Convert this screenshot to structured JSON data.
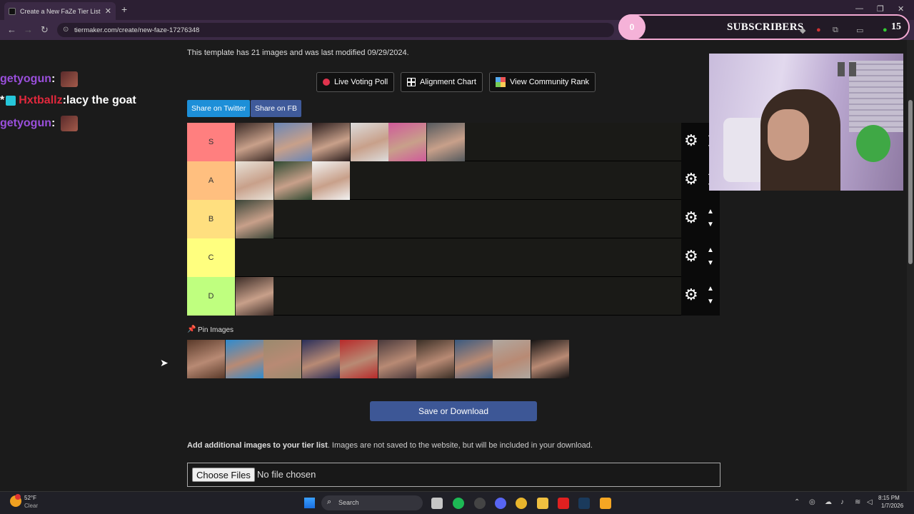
{
  "browser": {
    "tab_title": "Create a New FaZe Tier List - Ti",
    "tab_close": "✕",
    "new_tab": "+",
    "url": "tiermaker.com/create/new-faze-17276348",
    "back": "←",
    "forward": "→",
    "reload": "↻",
    "minimize": "—",
    "restore": "❐",
    "close": "✕"
  },
  "stream_overlay": {
    "subscriber_circle": "0",
    "subscribers_label": "SUBSCRIBERS",
    "subscriber_count": "15",
    "chat": [
      {
        "user": "getyogun",
        "sep": " :",
        "message": ""
      },
      {
        "user": "Hxtballz",
        "sep": " :",
        "message": " lacy the goat"
      },
      {
        "user": "getyogun",
        "sep": " :",
        "message": ""
      }
    ]
  },
  "page": {
    "info_text": "This template has 21 images and was last modified 09/29/2024.",
    "buttons": {
      "live_voting": "Live Voting Poll",
      "alignment_chart": "Alignment Chart",
      "community_rank": "View Community Rank",
      "share_twitter": "Share on Twitter",
      "share_fb": "Share on FB"
    },
    "tiers": [
      {
        "label": "S",
        "color": "#ff7f7f",
        "images": [
          "#3a2a26",
          "#6a86b6",
          "#2a1d1d",
          "#dcdcdc",
          "#d05a9a",
          "#555a5e"
        ]
      },
      {
        "label": "A",
        "color": "#ffbf7f",
        "images": [
          "#e8e2d8",
          "#2f4a32",
          "#f2f2f2"
        ]
      },
      {
        "label": "B",
        "color": "#ffdf7f",
        "images": [
          "#3a4538"
        ]
      },
      {
        "label": "C",
        "color": "#ffff7f",
        "images": []
      },
      {
        "label": "D",
        "color": "#bfff7f",
        "images": [
          "#3d2d28"
        ]
      }
    ],
    "pin_label": "Pin Images",
    "pool_images": [
      "#5a3a2a",
      "#2e8bd0",
      "#9a8a6e",
      "#2a2f5a",
      "#b82a2a",
      "#4a3a3c",
      "#3a2f26",
      "#3a5a80",
      "#b0a8a0",
      "#161414"
    ],
    "save_button": "Save or Download",
    "add_info_bold": "Add additional images to your tier list",
    "add_info_rest": ". Images are not saved to the website, but will be included in your download.",
    "choose_files": "Choose Files",
    "no_file": "No file chosen"
  },
  "taskbar": {
    "temperature": "52°F",
    "condition": "Clear",
    "search_label": "Search",
    "time": "8:15 PM",
    "date": "1/7/2026",
    "icons": [
      "file-explorer",
      "spotify",
      "obs",
      "discord",
      "chrome",
      "folder",
      "adobe",
      "steam",
      "app"
    ],
    "icon_colors": [
      "#c6c6c6",
      "#1db954",
      "#444",
      "#5865f2",
      "#e8b52c",
      "#f0c040",
      "#e02020",
      "#1a3a5c",
      "#f5a623"
    ]
  }
}
